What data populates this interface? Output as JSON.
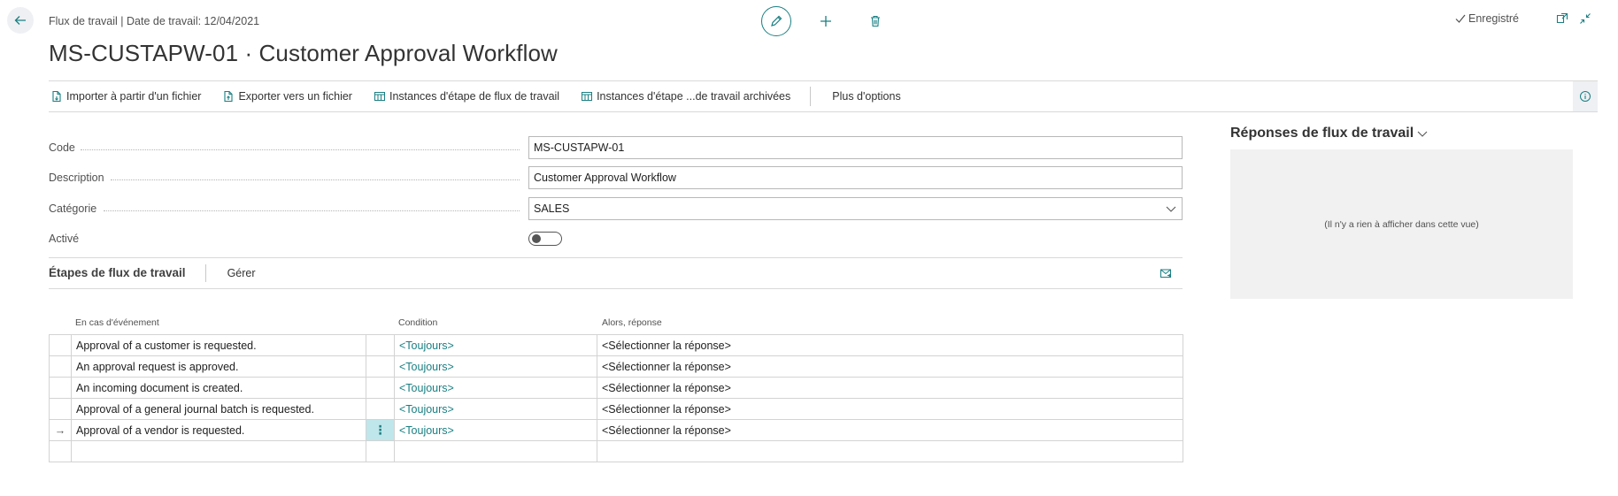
{
  "header": {
    "breadcrumb": "Flux de travail | Date de travail: 12/04/2021",
    "title": "MS-CUSTAPW-01 · Customer Approval Workflow",
    "status": "Enregistré"
  },
  "icons": {
    "back": "back-arrow-icon",
    "edit": "pencil-icon",
    "new": "plus-icon",
    "delete": "trash-icon",
    "open_new_window": "open-in-new-window-icon",
    "collapse": "collapse-icon",
    "info": "info-icon"
  },
  "actions": [
    {
      "label": "Importer à partir d'un fichier",
      "icon": "import-file-icon"
    },
    {
      "label": "Exporter vers un fichier",
      "icon": "export-file-icon"
    },
    {
      "label": "Instances d'étape de flux de travail",
      "icon": "table-icon"
    },
    {
      "label": "Instances d'étape ...de travail archivées",
      "icon": "table-icon"
    },
    {
      "label": "Plus d'options"
    }
  ],
  "fields": {
    "code": {
      "label": "Code",
      "value": "MS-CUSTAPW-01"
    },
    "description": {
      "label": "Description",
      "value": "Customer Approval Workflow"
    },
    "category": {
      "label": "Catégorie",
      "value": "SALES"
    },
    "enabled": {
      "label": "Activé",
      "value": false
    }
  },
  "steps": {
    "title": "Étapes de flux de travail",
    "manage": "Gérer",
    "columns": {
      "event": "En cas d'événement",
      "condition": "Condition",
      "response": "Alors, réponse"
    },
    "rows": [
      {
        "event": "Approval of a customer is requested.",
        "condition": "<Toujours>",
        "response": "<Sélectionner la réponse>"
      },
      {
        "event": "An approval request is approved.",
        "condition": "<Toujours>",
        "response": "<Sélectionner la réponse>"
      },
      {
        "event": "An incoming document is created.",
        "condition": "<Toujours>",
        "response": "<Sélectionner la réponse>"
      },
      {
        "event": "Approval of a general journal batch is requested.",
        "condition": "<Toujours>",
        "response": "<Sélectionner la réponse>"
      },
      {
        "event": "Approval of a vendor is requested.",
        "condition": "<Toujours>",
        "response": "<Sélectionner la réponse>",
        "current": true
      }
    ],
    "current_row_marker": "→",
    "row_menu": "⋮"
  },
  "responses_panel": {
    "title": "Réponses de flux de travail",
    "empty": "(Il n'y a rien à afficher dans cette vue)"
  },
  "colors": {
    "accent": "#1a7f83",
    "selected_cell": "#bfe6ea",
    "panel_bg": "#f1f1f1"
  }
}
